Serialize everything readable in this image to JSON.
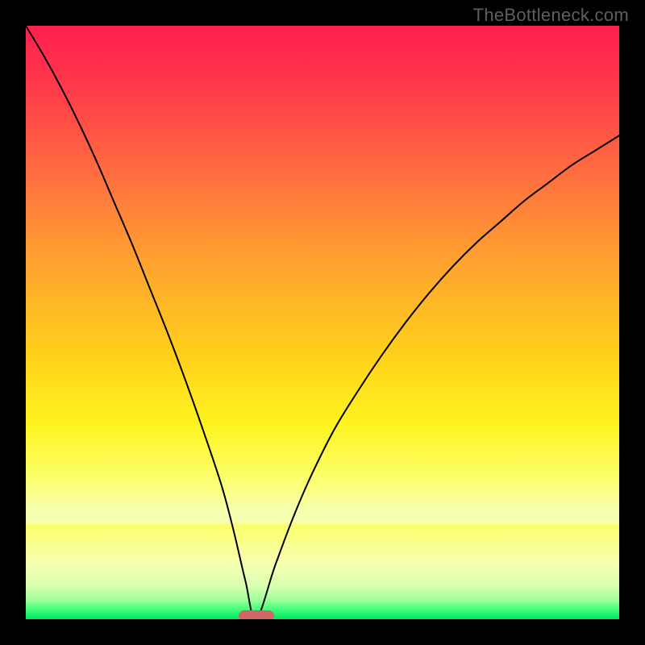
{
  "watermark": "TheBottleneck.com",
  "colors": {
    "frame": "#000000",
    "watermark": "#5f5f5f",
    "curve": "#000000",
    "marker": "#d06767"
  },
  "chart_data": {
    "type": "line",
    "title": "",
    "xlabel": "",
    "ylabel": "",
    "xlim": [
      0,
      100
    ],
    "ylim": [
      0,
      100
    ],
    "grid": false,
    "series": [
      {
        "name": "bottleneck-curve",
        "x": [
          0,
          3,
          6,
          9,
          12,
          15,
          18,
          21,
          24,
          27,
          30,
          33,
          35,
          37,
          38.8,
          42,
          45,
          48,
          52,
          56,
          60,
          64,
          68,
          72,
          76,
          80,
          84,
          88,
          92,
          96,
          100
        ],
        "y": [
          100,
          95,
          89.5,
          83.5,
          77,
          70,
          63,
          55.5,
          48,
          40,
          31.5,
          22.5,
          15,
          6.5,
          0,
          9,
          17,
          24,
          32,
          38.5,
          44.5,
          50,
          55,
          59.5,
          63.5,
          67,
          70.5,
          73.5,
          76.5,
          79,
          81.5
        ]
      }
    ],
    "annotations": [
      {
        "type": "rounded-marker",
        "x": 38.8,
        "y": 0,
        "width_fraction": 0.06
      }
    ],
    "background_gradient": [
      {
        "stop": 0.0,
        "color": "#ff1f4f"
      },
      {
        "stop": 0.12,
        "color": "#ff3b4a"
      },
      {
        "stop": 0.28,
        "color": "#ff6f3f"
      },
      {
        "stop": 0.45,
        "color": "#ffa52e"
      },
      {
        "stop": 0.62,
        "color": "#ffd21a"
      },
      {
        "stop": 0.74,
        "color": "#fff31f"
      },
      {
        "stop": 0.84,
        "color": "#fcff6a"
      },
      {
        "stop": 0.905,
        "color": "#f6ffb0"
      },
      {
        "stop": 0.945,
        "color": "#d8ffb0"
      },
      {
        "stop": 0.968,
        "color": "#9bff9a"
      },
      {
        "stop": 0.984,
        "color": "#3fff78"
      },
      {
        "stop": 1.0,
        "color": "#00e663"
      }
    ]
  }
}
